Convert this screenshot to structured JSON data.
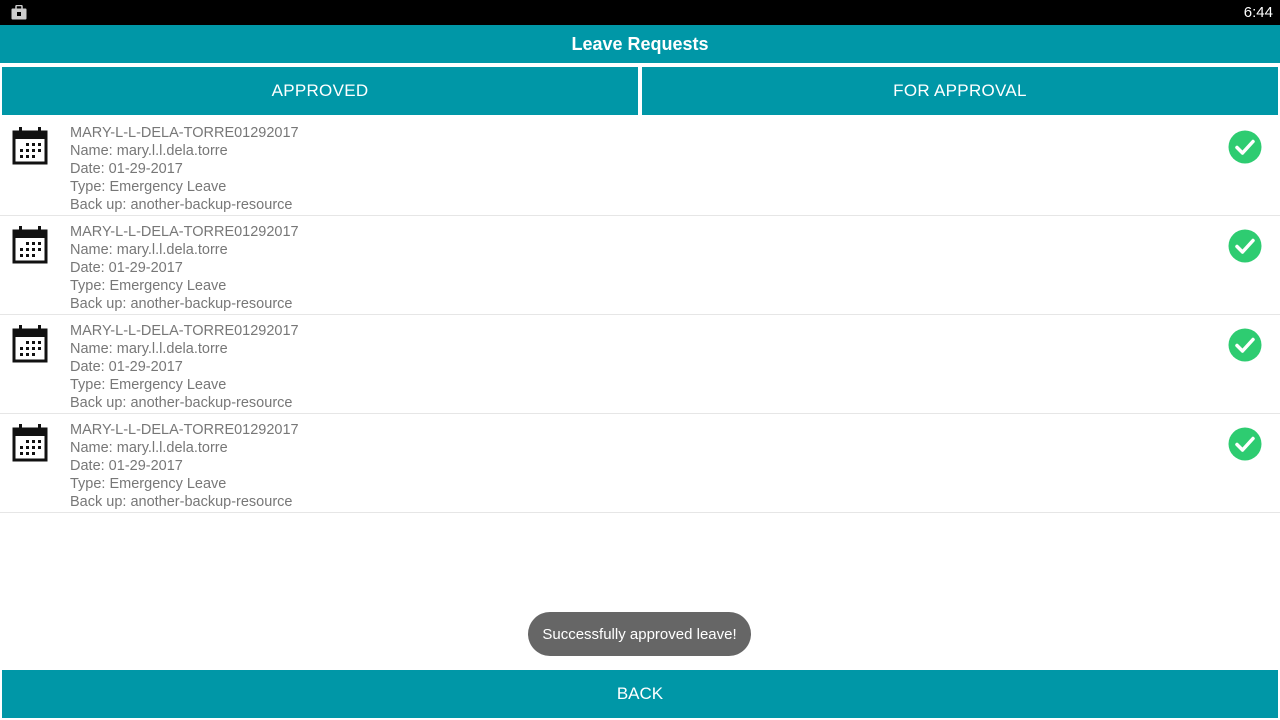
{
  "status_bar": {
    "time": "6:44",
    "left_icon": "shopping-bag-icon"
  },
  "header": {
    "title": "Leave Requests"
  },
  "tabs": [
    {
      "label": "APPROVED"
    },
    {
      "label": "FOR APPROVAL"
    }
  ],
  "leave_requests": [
    {
      "id": "MARY-L-L-DELA-TORRE01292017",
      "name": "Name: mary.l.l.dela.torre",
      "date": "Date: 01-29-2017",
      "type": "Type: Emergency Leave",
      "backup": "Back up: another-backup-resource",
      "icon": "calendar-icon",
      "status_icon": "approved-check-icon"
    },
    {
      "id": "MARY-L-L-DELA-TORRE01292017",
      "name": "Name: mary.l.l.dela.torre",
      "date": "Date: 01-29-2017",
      "type": "Type: Emergency Leave",
      "backup": "Back up: another-backup-resource",
      "icon": "calendar-icon",
      "status_icon": "approved-check-icon"
    },
    {
      "id": "MARY-L-L-DELA-TORRE01292017",
      "name": "Name: mary.l.l.dela.torre",
      "date": "Date: 01-29-2017",
      "type": "Type: Emergency Leave",
      "backup": "Back up: another-backup-resource",
      "icon": "calendar-icon",
      "status_icon": "approved-check-icon"
    },
    {
      "id": "MARY-L-L-DELA-TORRE01292017",
      "name": "Name: mary.l.l.dela.torre",
      "date": "Date: 01-29-2017",
      "type": "Type: Emergency Leave",
      "backup": "Back up: another-backup-resource",
      "icon": "calendar-icon",
      "status_icon": "approved-check-icon"
    }
  ],
  "toast": {
    "message": "Successfully approved leave!"
  },
  "footer": {
    "back_label": "BACK"
  },
  "colors": {
    "primary": "#0097A7",
    "approved_green": "#2ECC71",
    "toast_bg": "#666666",
    "text_gray": "#777777"
  }
}
